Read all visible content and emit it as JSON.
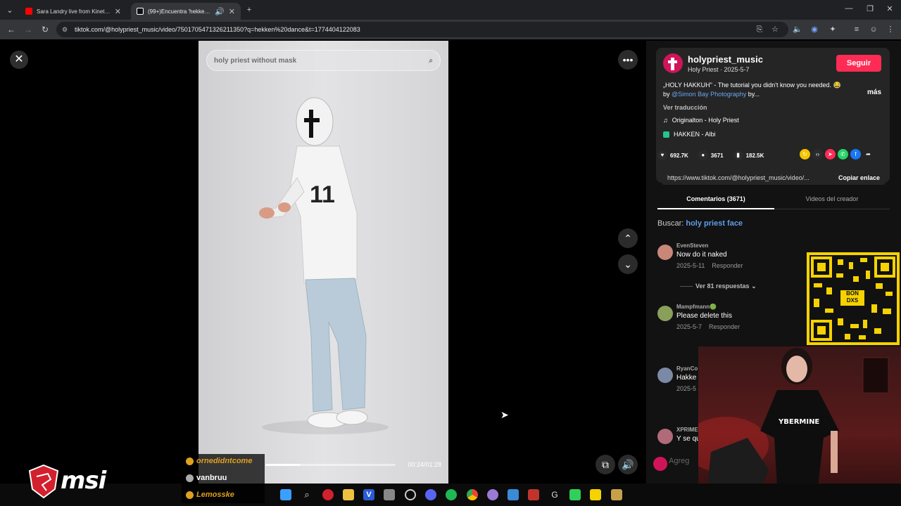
{
  "browser": {
    "tabs": [
      {
        "title": "Sara Landry live from Kinetic Fi",
        "favicon": "youtube-icon"
      },
      {
        "title": "(99+)Encuentra 'hekken dance'",
        "favicon": "tiktok-icon"
      }
    ],
    "url": "tiktok.com/@holypriest_music/video/7501705471326211350?q=hekken%20dance&t=1774404122083"
  },
  "video": {
    "search_placeholder": "holy priest without mask",
    "time": "00:24/01:28",
    "progress_fraction": 0.27
  },
  "post": {
    "username": "holypriest_music",
    "subtitle": "Holy Priest · 2025-5-7",
    "follow_label": "Seguir",
    "description_line1": "„HOLY HAKKUH\" - The tutorial you didn't know you needed. 😂",
    "description_by": "by",
    "description_mention": "@Simon Bay Photography",
    "description_tail": "by...",
    "more_label": "más",
    "translate_label": "Ver traducción",
    "sound": "Originalton - Holy Priest",
    "effect": "HAKKEN - Albi",
    "likes": "692.7K",
    "comments": "3671",
    "saves": "182.5K",
    "link": "https://www.tiktok.com/@holypriest_music/video/...",
    "copy_link_label": "Copiar enlace"
  },
  "comments_panel": {
    "tab_comments": "Comentarios (3671)",
    "tab_creator": "Videos del creador",
    "search_prefix": "Buscar:",
    "search_term": "holy priest face",
    "items": [
      {
        "user": "EvenSteven",
        "text": "Now do it naked",
        "date": "2025-5-11",
        "reply": "Responder"
      },
      {
        "user": "Mampfmann🟢",
        "text": "Please delete this",
        "date": "2025-5-7",
        "reply": "Responder"
      },
      {
        "user": "RyanCo",
        "text": "Hakke",
        "date": "2025-5",
        "reply": ""
      },
      {
        "user": "XPRIME",
        "text": "Y se qu",
        "date": "",
        "reply": ""
      }
    ],
    "view_replies": "Ver 81 respuestas",
    "input_placeholder": "Agreg"
  },
  "qr_text": "BON\nDXS",
  "stream_chat": [
    {
      "name": "ornedidntcome",
      "color": "#e0a020"
    },
    {
      "name": "vanbruu",
      "color": "#ffffff"
    },
    {
      "name": "Lemosske",
      "color": "#e0a020"
    }
  ],
  "brand": "msi"
}
